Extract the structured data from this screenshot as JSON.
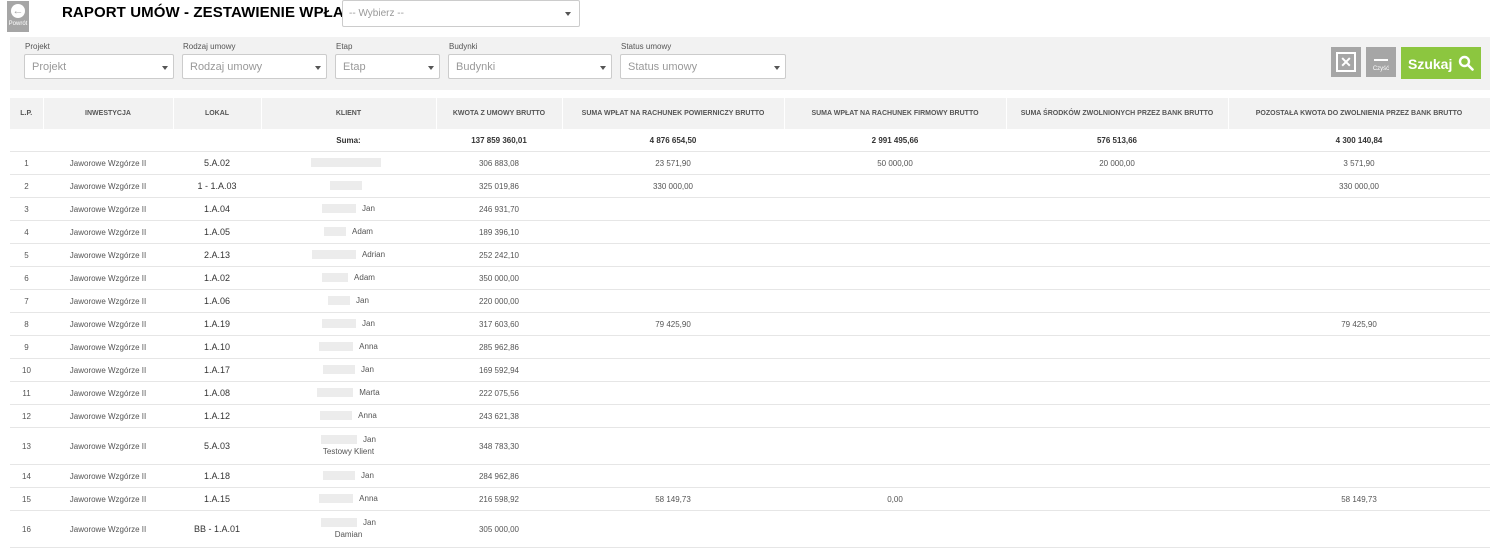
{
  "header": {
    "back_label": "Powrót",
    "title": "RAPORT UMÓW - ZESTAWIENIE WPŁAT",
    "select_value": "-- Wybierz --"
  },
  "filters": [
    {
      "label": "Projekt",
      "placeholder": "Projekt"
    },
    {
      "label": "Rodzaj umowy",
      "placeholder": "Rodzaj umowy"
    },
    {
      "label": "Etap",
      "placeholder": "Etap"
    },
    {
      "label": "Budynki",
      "placeholder": "Budynki"
    },
    {
      "label": "Status umowy",
      "placeholder": "Status umowy"
    }
  ],
  "buttons": {
    "clear_label": "Czyść",
    "search_label": "Szukaj",
    "accent_color": "#8cc63f"
  },
  "table": {
    "columns": [
      "L.P.",
      "INWESTYCJA",
      "LOKAL",
      "KLIENT",
      "KWOTA Z UMOWY BRUTTO",
      "SUMA WPŁAT NA RACHUNEK POWIERNICZY BRUTTO",
      "SUMA WPŁAT NA RACHUNEK FIRMOWY BRUTTO",
      "SUMA ŚRODKÓW ZWOLNIONYCH PRZEZ BANK BRUTTO",
      "POZOSTAŁA KWOTA DO ZWOLNIENIA PRZEZ BANK BRUTTO"
    ],
    "sum": {
      "label": "Suma:",
      "kwota": "137 859 360,01",
      "powierniczy": "4 876 654,50",
      "firmowy": "2 991 495,66",
      "zwolnione": "576 513,66",
      "pozostala": "4 300 140,84"
    },
    "rows": [
      {
        "lp": "1",
        "inwestycja": "Jaworowe Wzgórze II",
        "lokal": "5.A.02",
        "klient": [
          "",
          ""
        ],
        "kwota": "306 883,08",
        "powierniczy": "23 571,90",
        "firmowy": "50 000,00",
        "zwolnione": "20 000,00",
        "pozostala": "3 571,90"
      },
      {
        "lp": "2",
        "inwestycja": "Jaworowe Wzgórze II",
        "lokal": "1 - 1.A.03",
        "klient": [
          "",
          ""
        ],
        "kwota": "325 019,86",
        "powierniczy": "330 000,00",
        "firmowy": "",
        "zwolnione": "",
        "pozostala": "330 000,00"
      },
      {
        "lp": "3",
        "inwestycja": "Jaworowe Wzgórze II",
        "lokal": "1.A.04",
        "klient": [
          "Jan",
          ""
        ],
        "kwota": "246 931,70",
        "powierniczy": "",
        "firmowy": "",
        "zwolnione": "",
        "pozostala": ""
      },
      {
        "lp": "4",
        "inwestycja": "Jaworowe Wzgórze II",
        "lokal": "1.A.05",
        "klient": [
          "Adam",
          ""
        ],
        "kwota": "189 396,10",
        "powierniczy": "",
        "firmowy": "",
        "zwolnione": "",
        "pozostala": ""
      },
      {
        "lp": "5",
        "inwestycja": "Jaworowe Wzgórze II",
        "lokal": "2.A.13",
        "klient": [
          "Adrian",
          ""
        ],
        "kwota": "252 242,10",
        "powierniczy": "",
        "firmowy": "",
        "zwolnione": "",
        "pozostala": ""
      },
      {
        "lp": "6",
        "inwestycja": "Jaworowe Wzgórze II",
        "lokal": "1.A.02",
        "klient": [
          "Adam",
          ""
        ],
        "kwota": "350 000,00",
        "powierniczy": "",
        "firmowy": "",
        "zwolnione": "",
        "pozostala": ""
      },
      {
        "lp": "7",
        "inwestycja": "Jaworowe Wzgórze II",
        "lokal": "1.A.06",
        "klient": [
          "Jan",
          ""
        ],
        "kwota": "220 000,00",
        "powierniczy": "",
        "firmowy": "",
        "zwolnione": "",
        "pozostala": ""
      },
      {
        "lp": "8",
        "inwestycja": "Jaworowe Wzgórze II",
        "lokal": "1.A.19",
        "klient": [
          "Jan",
          ""
        ],
        "kwota": "317 603,60",
        "powierniczy": "79 425,90",
        "firmowy": "",
        "zwolnione": "",
        "pozostala": "79 425,90"
      },
      {
        "lp": "9",
        "inwestycja": "Jaworowe Wzgórze II",
        "lokal": "1.A.10",
        "klient": [
          "Anna",
          ""
        ],
        "kwota": "285 962,86",
        "powierniczy": "",
        "firmowy": "",
        "zwolnione": "",
        "pozostala": ""
      },
      {
        "lp": "10",
        "inwestycja": "Jaworowe Wzgórze II",
        "lokal": "1.A.17",
        "klient": [
          "Jan",
          ""
        ],
        "kwota": "169 592,94",
        "powierniczy": "",
        "firmowy": "",
        "zwolnione": "",
        "pozostala": ""
      },
      {
        "lp": "11",
        "inwestycja": "Jaworowe Wzgórze II",
        "lokal": "1.A.08",
        "klient": [
          "Marta",
          ""
        ],
        "kwota": "222 075,56",
        "powierniczy": "",
        "firmowy": "",
        "zwolnione": "",
        "pozostala": ""
      },
      {
        "lp": "12",
        "inwestycja": "Jaworowe Wzgórze II",
        "lokal": "1.A.12",
        "klient": [
          "Anna",
          ""
        ],
        "kwota": "243 621,38",
        "powierniczy": "",
        "firmowy": "",
        "zwolnione": "",
        "pozostala": ""
      },
      {
        "lp": "13",
        "inwestycja": "Jaworowe Wzgórze II",
        "lokal": "5.A.03",
        "klient": [
          "Jan",
          "Testowy Klient"
        ],
        "kwota": "348 783,30",
        "powierniczy": "",
        "firmowy": "",
        "zwolnione": "",
        "pozostala": ""
      },
      {
        "lp": "14",
        "inwestycja": "Jaworowe Wzgórze II",
        "lokal": "1.A.18",
        "klient": [
          "Jan",
          ""
        ],
        "kwota": "284 962,86",
        "powierniczy": "",
        "firmowy": "",
        "zwolnione": "",
        "pozostala": ""
      },
      {
        "lp": "15",
        "inwestycja": "Jaworowe Wzgórze II",
        "lokal": "1.A.15",
        "klient": [
          "Anna",
          ""
        ],
        "kwota": "216 598,92",
        "powierniczy": "58 149,73",
        "firmowy": "0,00",
        "zwolnione": "",
        "pozostala": "58 149,73"
      },
      {
        "lp": "16",
        "inwestycja": "Jaworowe Wzgórze II",
        "lokal": "BB - 1.A.01",
        "klient": [
          "Jan",
          "Damian"
        ],
        "kwota": "305 000,00",
        "powierniczy": "",
        "firmowy": "",
        "zwolnione": "",
        "pozostala": ""
      }
    ]
  }
}
